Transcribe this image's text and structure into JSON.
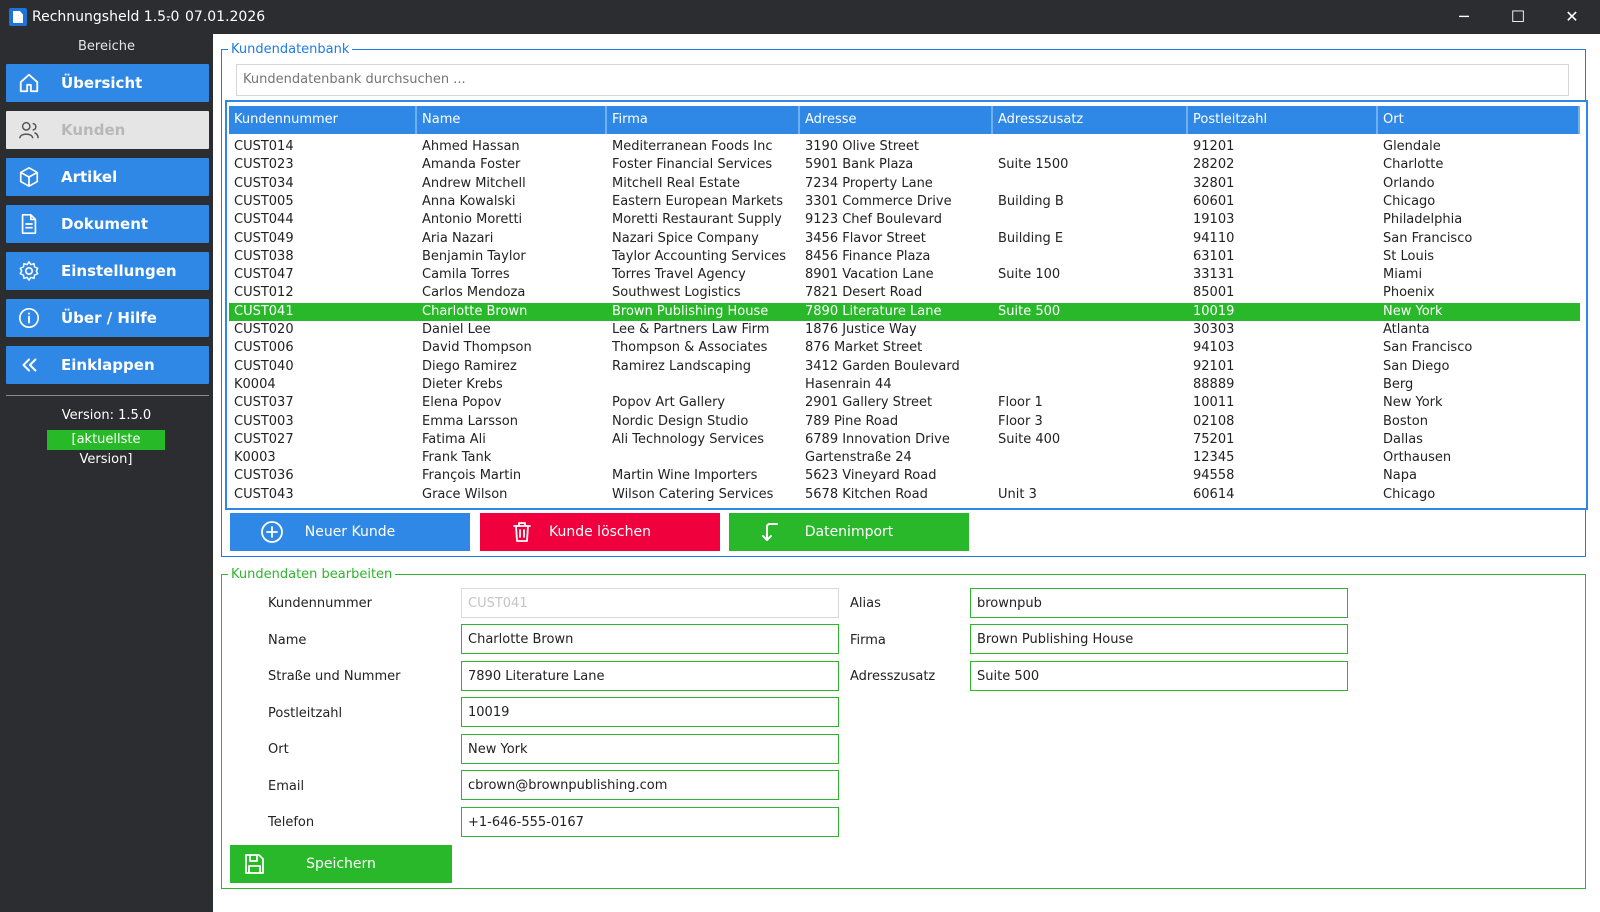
{
  "window": {
    "title": "Rechnungsheld 1.5.0",
    "date": "07.01.2026",
    "minimize_icon": "minimize-icon",
    "maximize_icon": "maximize-icon",
    "close_icon": "close-icon"
  },
  "sidebar": {
    "title": "Bereiche",
    "items": [
      {
        "label": "Übersicht",
        "icon": "home-icon"
      },
      {
        "label": "Kunden",
        "icon": "users-icon"
      },
      {
        "label": "Artikel",
        "icon": "box-icon"
      },
      {
        "label": "Dokument",
        "icon": "document-icon"
      },
      {
        "label": "Einstellungen",
        "icon": "gear-icon"
      },
      {
        "label": "Über / Hilfe",
        "icon": "info-icon"
      },
      {
        "label": "Einklappen",
        "icon": "chevrons-left-icon"
      }
    ],
    "active_index": 1,
    "version": "Version: 1.5.0",
    "version_status": "[aktuellste Version]"
  },
  "colors": {
    "accent_blue": "#2f88e6",
    "success_green": "#29b829",
    "danger_red": "#f0003c",
    "active_nav_bg": "#e5e5e5"
  },
  "customers": {
    "group_title": "Kundendatenbank",
    "search_placeholder": "Kundendatenbank durchsuchen ...",
    "columns": [
      "Kundennummer",
      "Name",
      "Firma",
      "Adresse",
      "Adresszusatz",
      "Postleitzahl",
      "Ort"
    ],
    "rows": [
      [
        "CUST014",
        "Ahmed Hassan",
        "Mediterranean Foods Inc",
        "3190 Olive Street",
        "",
        "91201",
        "Glendale"
      ],
      [
        "CUST023",
        "Amanda Foster",
        "Foster Financial Services",
        "5901 Bank Plaza",
        "Suite 1500",
        "28202",
        "Charlotte"
      ],
      [
        "CUST034",
        "Andrew Mitchell",
        "Mitchell Real Estate",
        "7234 Property Lane",
        "",
        "32801",
        "Orlando"
      ],
      [
        "CUST005",
        "Anna Kowalski",
        "Eastern European Markets",
        "3301 Commerce Drive",
        "Building B",
        "60601",
        "Chicago"
      ],
      [
        "CUST044",
        "Antonio Moretti",
        "Moretti Restaurant Supply",
        "9123 Chef Boulevard",
        "",
        "19103",
        "Philadelphia"
      ],
      [
        "CUST049",
        "Aria Nazari",
        "Nazari Spice Company",
        "3456 Flavor Street",
        "Building E",
        "94110",
        "San Francisco"
      ],
      [
        "CUST038",
        "Benjamin Taylor",
        "Taylor Accounting Services",
        "8456 Finance Plaza",
        "",
        "63101",
        "St Louis"
      ],
      [
        "CUST047",
        "Camila Torres",
        "Torres Travel Agency",
        "8901 Vacation Lane",
        "Suite 100",
        "33131",
        "Miami"
      ],
      [
        "CUST012",
        "Carlos Mendoza",
        "Southwest Logistics",
        "7821 Desert Road",
        "",
        "85001",
        "Phoenix"
      ],
      [
        "CUST041",
        "Charlotte Brown",
        "Brown Publishing House",
        "7890 Literature Lane",
        "Suite 500",
        "10019",
        "New York"
      ],
      [
        "CUST020",
        "Daniel Lee",
        "Lee & Partners Law Firm",
        "1876 Justice Way",
        "",
        "30303",
        "Atlanta"
      ],
      [
        "CUST006",
        "David Thompson",
        "Thompson & Associates",
        "876 Market Street",
        "",
        "94103",
        "San Francisco"
      ],
      [
        "CUST040",
        "Diego Ramirez",
        "Ramirez Landscaping",
        "3412 Garden Boulevard",
        "",
        "92101",
        "San Diego"
      ],
      [
        "K0004",
        "Dieter Krebs",
        "",
        "Hasenrain 44",
        "",
        "88889",
        "Berg"
      ],
      [
        "CUST037",
        "Elena Popov",
        "Popov Art Gallery",
        "2901 Gallery Street",
        "Floor 1",
        "10011",
        "New York"
      ],
      [
        "CUST003",
        "Emma Larsson",
        "Nordic Design Studio",
        "789 Pine Road",
        "Floor 3",
        "02108",
        "Boston"
      ],
      [
        "CUST027",
        "Fatima Ali",
        "Ali Technology Services",
        "6789 Innovation Drive",
        "Suite 400",
        "75201",
        "Dallas"
      ],
      [
        "K0003",
        "Frank Tank",
        "",
        "Gartenstraße 24",
        "",
        "12345",
        "Orthausen"
      ],
      [
        "CUST036",
        "François Martin",
        "Martin Wine Importers",
        "5623 Vineyard Road",
        "",
        "94558",
        "Napa"
      ],
      [
        "CUST043",
        "Grace Wilson",
        "Wilson Catering Services",
        "5678 Kitchen Road",
        "Unit 3",
        "60614",
        "Chicago"
      ]
    ],
    "selected_index": 9,
    "buttons": {
      "new": "Neuer Kunde",
      "delete": "Kunde löschen",
      "import": "Datenimport"
    }
  },
  "edit": {
    "group_title": "Kundendaten bearbeiten",
    "labels": {
      "kundennummer": "Kundennummer",
      "name": "Name",
      "strasse": "Straße und Nummer",
      "plz": "Postleitzahl",
      "ort": "Ort",
      "email": "Email",
      "telefon": "Telefon",
      "alias": "Alias",
      "firma": "Firma",
      "adresszusatz": "Adresszusatz"
    },
    "values": {
      "kundennummer": "CUST041",
      "name": "Charlotte Brown",
      "strasse": "7890 Literature Lane",
      "plz": "10019",
      "ort": "New York",
      "email": "cbrown@brownpublishing.com",
      "telefon": "+1-646-555-0167",
      "alias": "brownpub",
      "firma": "Brown Publishing House",
      "adresszusatz": "Suite 500"
    },
    "save_label": "Speichern"
  }
}
